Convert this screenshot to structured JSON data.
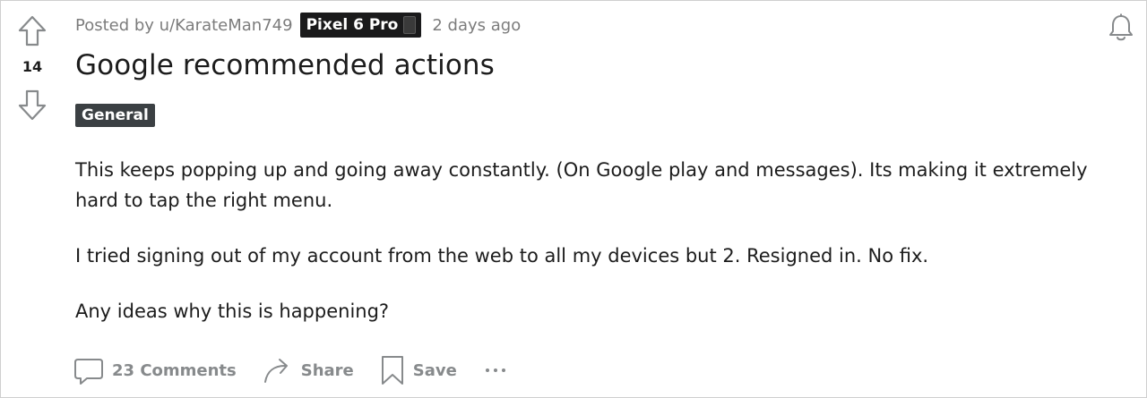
{
  "post": {
    "score": "14",
    "posted_by": "Posted by u/KarateMan749",
    "user_flair": "Pixel 6 Pro",
    "time_ago": "2 days ago",
    "title": "Google recommended actions",
    "post_flair": "General",
    "body": [
      "This keeps popping up and going away constantly. (On Google play and messages). Its making it extremely hard to tap the right menu.",
      "I tried signing out of my account from the web to all my devices but 2. Resigned in. No fix.",
      "Any ideas why this is happening?"
    ]
  },
  "actions": {
    "comments_label": "23 Comments",
    "share_label": "Share",
    "save_label": "Save"
  },
  "icons": {
    "upvote": "arrow-up-outline-icon",
    "downvote": "arrow-down-outline-icon",
    "comment": "speech-bubble-icon",
    "share": "curved-arrow-icon",
    "save": "bookmark-icon",
    "more": "ellipsis-icon",
    "notify": "bell-icon"
  },
  "colors": {
    "text": "#1c1c1c",
    "meta": "#7c7c7c",
    "action": "#878a8c",
    "user_flair_bg": "#1a1a1b",
    "post_flair_bg": "#3b4043"
  }
}
